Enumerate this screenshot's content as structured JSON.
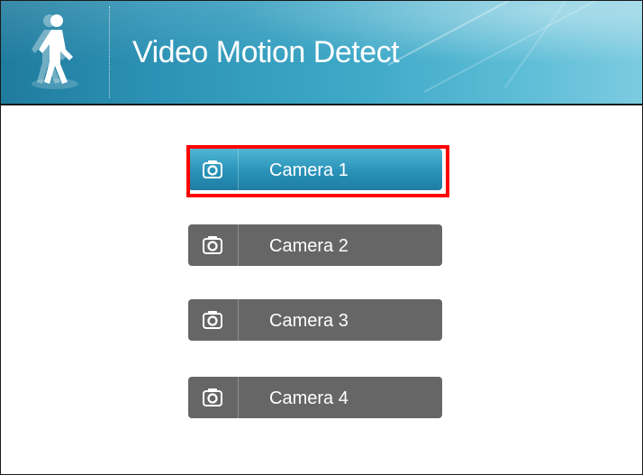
{
  "header": {
    "title": "Video Motion Detect",
    "icon": "walking-person-icon",
    "gradient_start": "#1f7b9e",
    "gradient_end": "#7ccbe0"
  },
  "cameras": [
    {
      "label": "Camera 1",
      "icon": "camera-icon",
      "selected": true
    },
    {
      "label": "Camera 2",
      "icon": "camera-icon",
      "selected": false
    },
    {
      "label": "Camera 3",
      "icon": "camera-icon",
      "selected": false
    },
    {
      "label": "Camera 4",
      "icon": "camera-icon",
      "selected": false
    }
  ],
  "colors": {
    "button_default": "#666666",
    "button_selected": "#2a92b8",
    "selection_outline": "#ff0000"
  }
}
